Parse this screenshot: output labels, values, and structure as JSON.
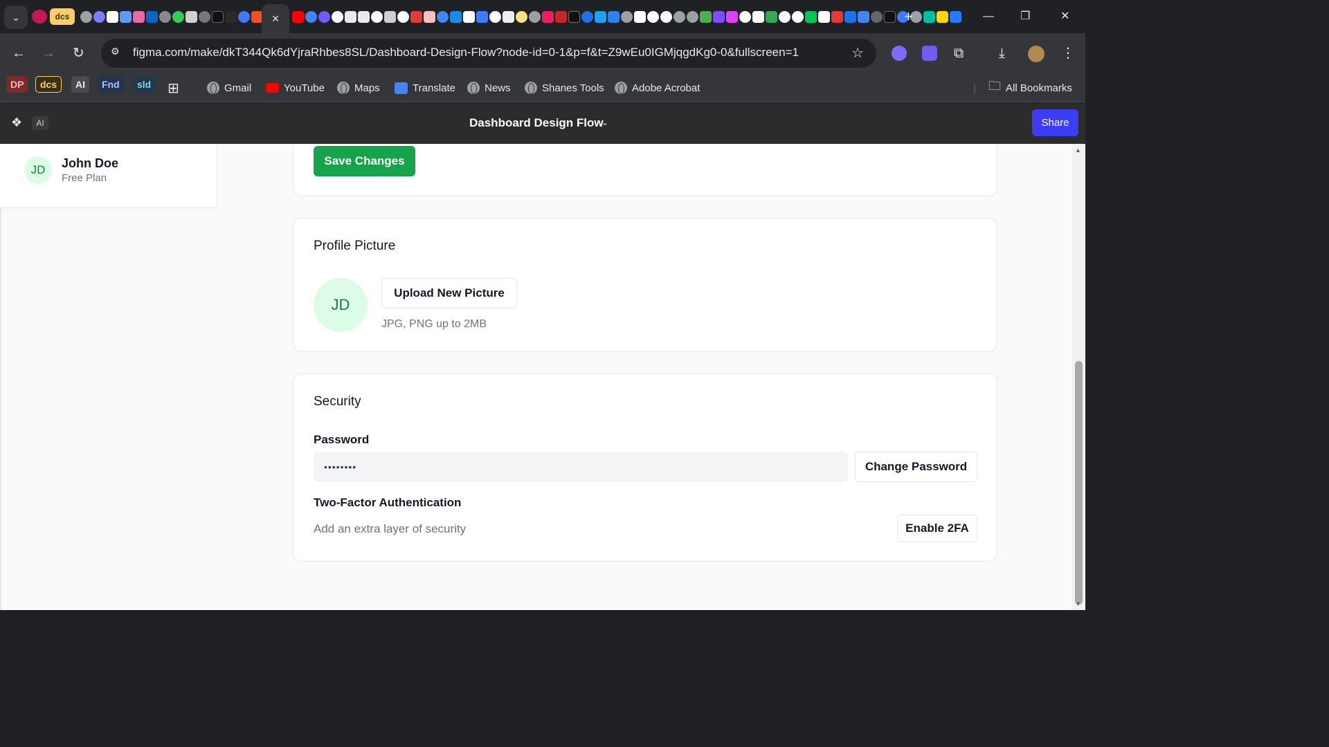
{
  "browser": {
    "tab_search_icon": "chevron-down-icon",
    "pinned_tab_dcs": "dcs",
    "active_tab_close": "×",
    "new_tab_label": "+",
    "window_controls": {
      "minimize": "—",
      "restore": "❐",
      "close": "✕"
    },
    "url": "figma.com/make/dkT344Qk6dYjraRhbes8SL/Dashboard-Design-Flow?node-id=0-1&p=f&t=Z9wEu0IGMjqgdKg0-0&fullscreen=1",
    "bookmarks": {
      "chips": [
        "DP",
        "dcs",
        "AI",
        "Fnd",
        "sld"
      ],
      "items": [
        "Gmail",
        "YouTube",
        "Maps",
        "Translate",
        "News",
        "Shanes Tools",
        "Adobe Acrobat"
      ],
      "all_bookmarks": "All Bookmarks"
    },
    "colors": {
      "tab_strip": "#202124",
      "toolbar": "#35363a"
    }
  },
  "figma": {
    "ai_badge": "AI",
    "file_title": "Dashboard Design Flow",
    "share_label": "Share",
    "colors": {
      "share": "#3d3df5"
    }
  },
  "sidebar": {
    "avatar_initials": "JD",
    "user_name": "John Doe",
    "plan": "Free Plan"
  },
  "main": {
    "save_button": "Save Changes",
    "profile_picture": {
      "title": "Profile Picture",
      "avatar_initials": "JD",
      "upload_button": "Upload New Picture",
      "hint": "JPG, PNG up to 2MB"
    },
    "security": {
      "title": "Security",
      "password_label": "Password",
      "password_value": "••••••••",
      "change_password_button": "Change Password",
      "two_factor_label": "Two-Factor Authentication",
      "two_factor_desc": "Add an extra layer of security",
      "enable_2fa_button": "Enable 2FA"
    },
    "colors": {
      "primary_green": "#16a34a",
      "avatar_bg": "#dcfce7",
      "avatar_text": "#15803d"
    }
  }
}
